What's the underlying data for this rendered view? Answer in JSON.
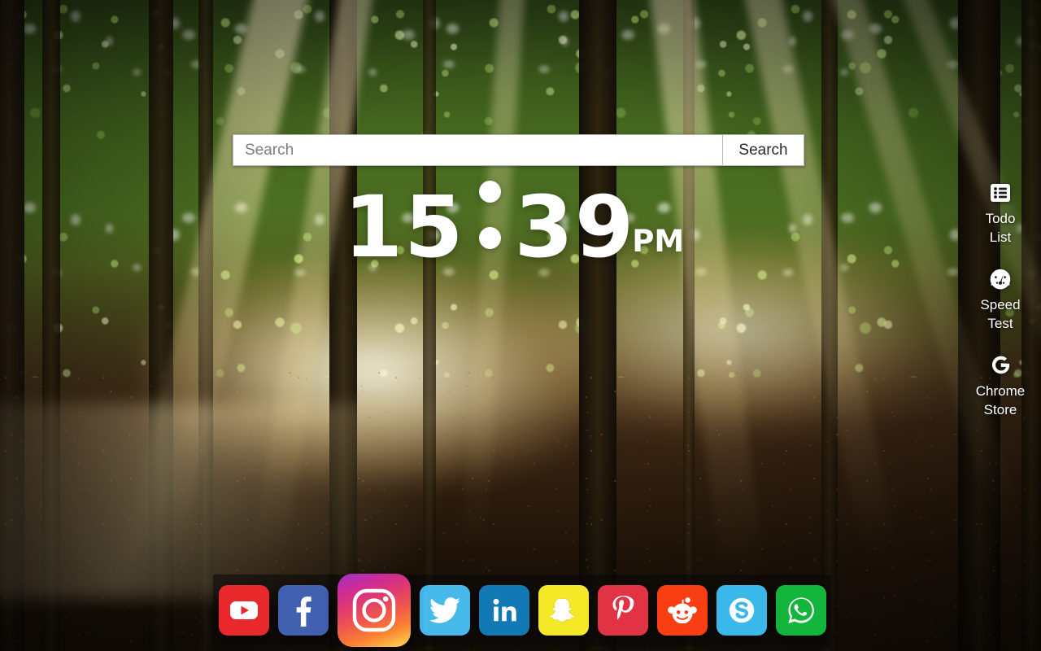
{
  "page": {
    "title": "New Tab"
  },
  "wallpaper": {
    "scene": "sunlit-forest-with-god-rays",
    "alt": "Sunbeams streaming through a green forest onto a leaf covered path"
  },
  "search": {
    "placeholder": "Search",
    "value": "",
    "button_label": "Search"
  },
  "clock": {
    "hours": "15",
    "separator": ":",
    "minutes": "39",
    "meridiem": "PM",
    "full": "15 : 39 PM",
    "color": "#ffffff"
  },
  "sidebar": {
    "items": [
      {
        "icon": "todo-list-icon",
        "label": "Todo\nList",
        "line1": "Todo",
        "line2": "List"
      },
      {
        "icon": "speedometer-icon",
        "label": "Speed\nTest",
        "line1": "Speed",
        "line2": "Test"
      },
      {
        "icon": "google-g-icon",
        "label": "Chrome\nStore",
        "line1": "Chrome",
        "line2": "Store"
      }
    ]
  },
  "dock": {
    "background": "#080808",
    "items": [
      {
        "name": "youtube",
        "label": "YouTube",
        "icon": "youtube-icon",
        "color": "#e8282b",
        "hovered": false
      },
      {
        "name": "facebook",
        "label": "Facebook",
        "icon": "facebook-icon",
        "color": "#4260b0",
        "hovered": false
      },
      {
        "name": "instagram",
        "label": "Instagram",
        "icon": "instagram-icon",
        "color": "#d6249f",
        "hovered": true
      },
      {
        "name": "twitter",
        "label": "Twitter",
        "icon": "twitter-icon",
        "color": "#46b8ea",
        "hovered": false
      },
      {
        "name": "linkedin",
        "label": "LinkedIn",
        "icon": "linkedin-icon",
        "color": "#1379b5",
        "hovered": false
      },
      {
        "name": "snapchat",
        "label": "Snapchat",
        "icon": "snapchat-icon",
        "color": "#f5e827",
        "hovered": false
      },
      {
        "name": "pinterest",
        "label": "Pinterest",
        "icon": "pinterest-icon",
        "color": "#e23345",
        "hovered": false
      },
      {
        "name": "reddit",
        "label": "Reddit",
        "icon": "reddit-icon",
        "color": "#f93e13",
        "hovered": false
      },
      {
        "name": "skype",
        "label": "Skype",
        "icon": "skype-icon",
        "color": "#3ab8ea",
        "hovered": false
      },
      {
        "name": "whatsapp",
        "label": "WhatsApp",
        "icon": "whatsapp-icon",
        "color": "#13b53d",
        "hovered": false
      }
    ]
  }
}
